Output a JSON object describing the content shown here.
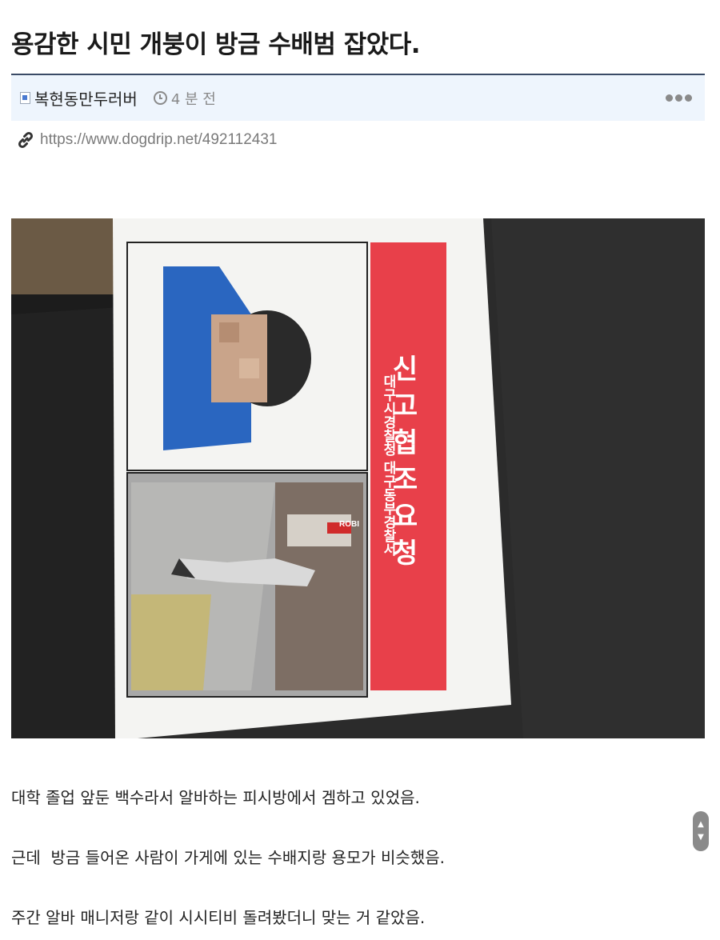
{
  "post": {
    "title": "용감한 시민 개붕이 방금 수배범 잡았다.",
    "author": "복현동만두러버",
    "time": "4 분 전",
    "url": "https://www.dogdrip.net/492112431"
  },
  "flyer": {
    "heading": "신고협조요청",
    "agencies": "대구시경찰청 대구동부경찰서",
    "sign": "ROBI"
  },
  "paragraphs": [
    "대학 졸업 앞둔 백수라서 알바하는 피시방에서 겜하고 있었음.",
    "근데  방금 들어온 사람이 가게에 있는 수배지랑 용모가 비슷했음.",
    "주간 알바 매니저랑 같이 시시티비 돌려봤더니 맞는 거 같았음."
  ],
  "icons": {
    "author": "author-avatar-icon",
    "clock": "clock-icon",
    "more": "more-options-icon",
    "link": "link-icon"
  },
  "colors": {
    "title_rule": "#3a4a66",
    "meta_bg": "#eef5fd",
    "flyer_red": "#e8404a"
  }
}
